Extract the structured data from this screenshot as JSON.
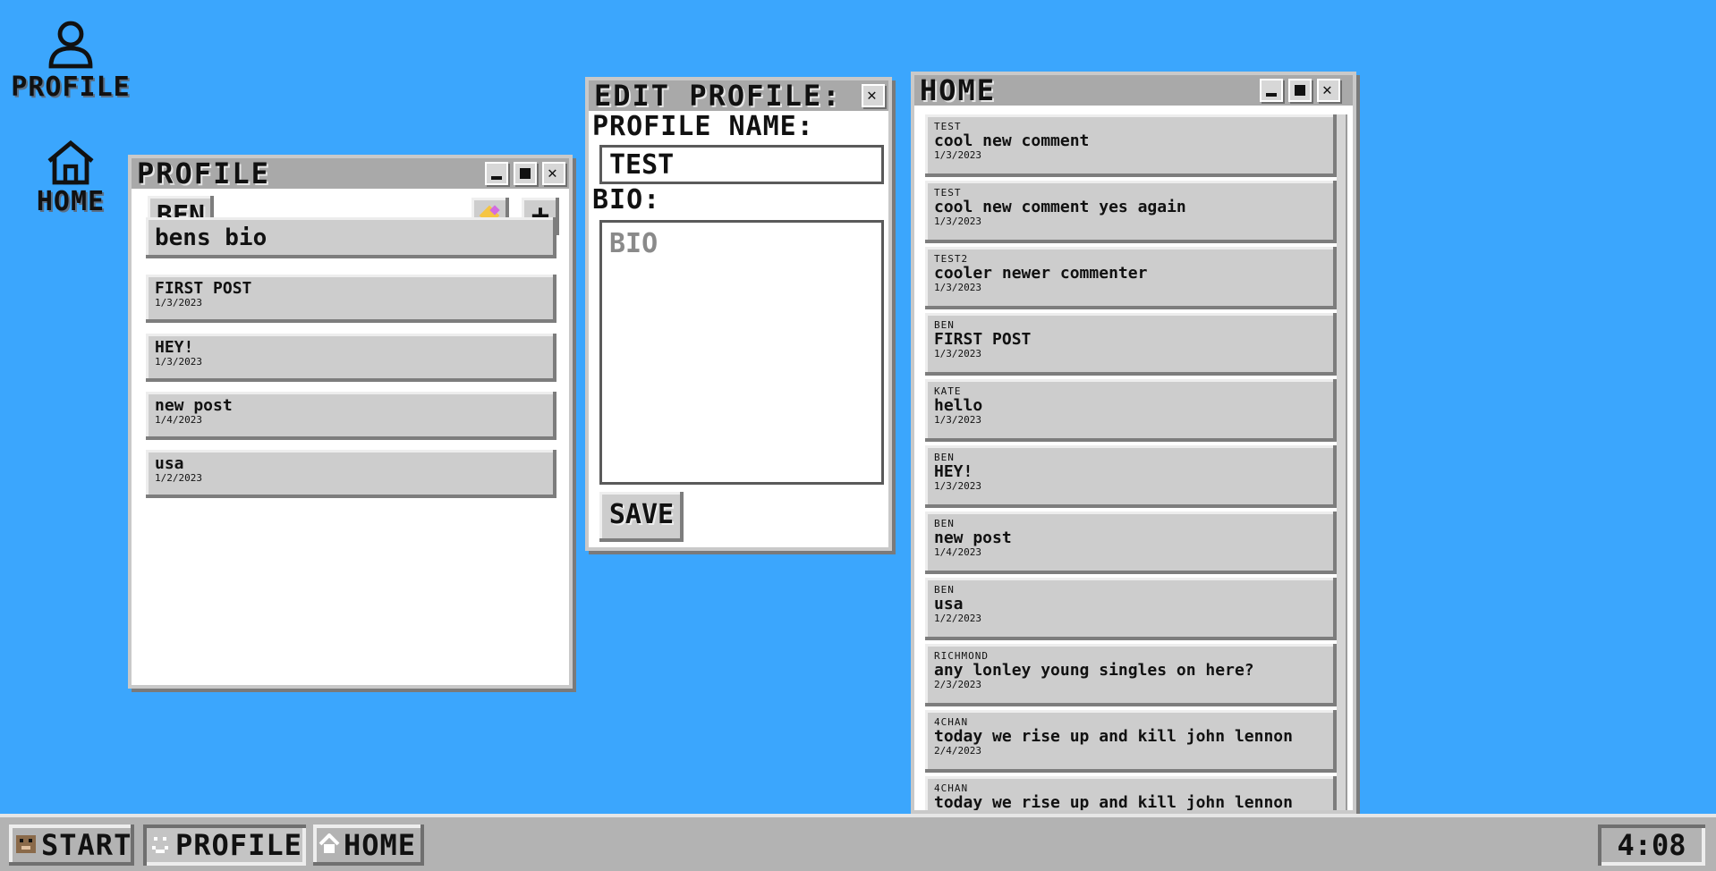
{
  "desktop": {
    "icons": [
      {
        "label": "PROFILE",
        "icon": "person-icon"
      },
      {
        "label": "HOME",
        "icon": "house-icon"
      }
    ]
  },
  "profile_window": {
    "title": "PROFILE",
    "name_button": "BEN",
    "edit_icon": "pencil-icon",
    "add_label": "+",
    "bio": "bens bio",
    "posts": [
      {
        "title": "FIRST POST",
        "date": "1/3/2023"
      },
      {
        "title": "HEY!",
        "date": "1/3/2023"
      },
      {
        "title": "new post",
        "date": "1/4/2023"
      },
      {
        "title": "usa",
        "date": "1/2/2023"
      }
    ]
  },
  "edit_window": {
    "title": "EDIT PROFILE:",
    "name_label": "PROFILE NAME:",
    "name_value": "TEST",
    "bio_label": "BIO:",
    "bio_placeholder": "BIO",
    "save_label": "SAVE"
  },
  "home_window": {
    "title": "HOME",
    "feed": [
      {
        "user": "TEST",
        "text": "cool new comment",
        "date": "1/3/2023"
      },
      {
        "user": "TEST",
        "text": "cool new comment yes again",
        "date": "1/3/2023"
      },
      {
        "user": "TEST2",
        "text": "cooler newer commenter",
        "date": "1/3/2023"
      },
      {
        "user": "BEN",
        "text": "FIRST POST",
        "date": "1/3/2023"
      },
      {
        "user": "KATE",
        "text": "hello",
        "date": "1/3/2023"
      },
      {
        "user": "BEN",
        "text": "HEY!",
        "date": "1/3/2023"
      },
      {
        "user": "BEN",
        "text": "new post",
        "date": "1/4/2023"
      },
      {
        "user": "BEN",
        "text": "usa",
        "date": "1/2/2023"
      },
      {
        "user": "RICHMOND",
        "text": "any lonley young singles on here?",
        "date": "2/3/2023"
      },
      {
        "user": "4CHAN",
        "text": "today we rise up and kill john lennon",
        "date": "2/4/2023"
      },
      {
        "user": "4CHAN",
        "text": "today we rise up and kill john lennon",
        "date": ""
      }
    ]
  },
  "taskbar": {
    "start_label": "START",
    "profile_label": "PROFILE",
    "home_label": "HOME",
    "clock": "4:08"
  }
}
